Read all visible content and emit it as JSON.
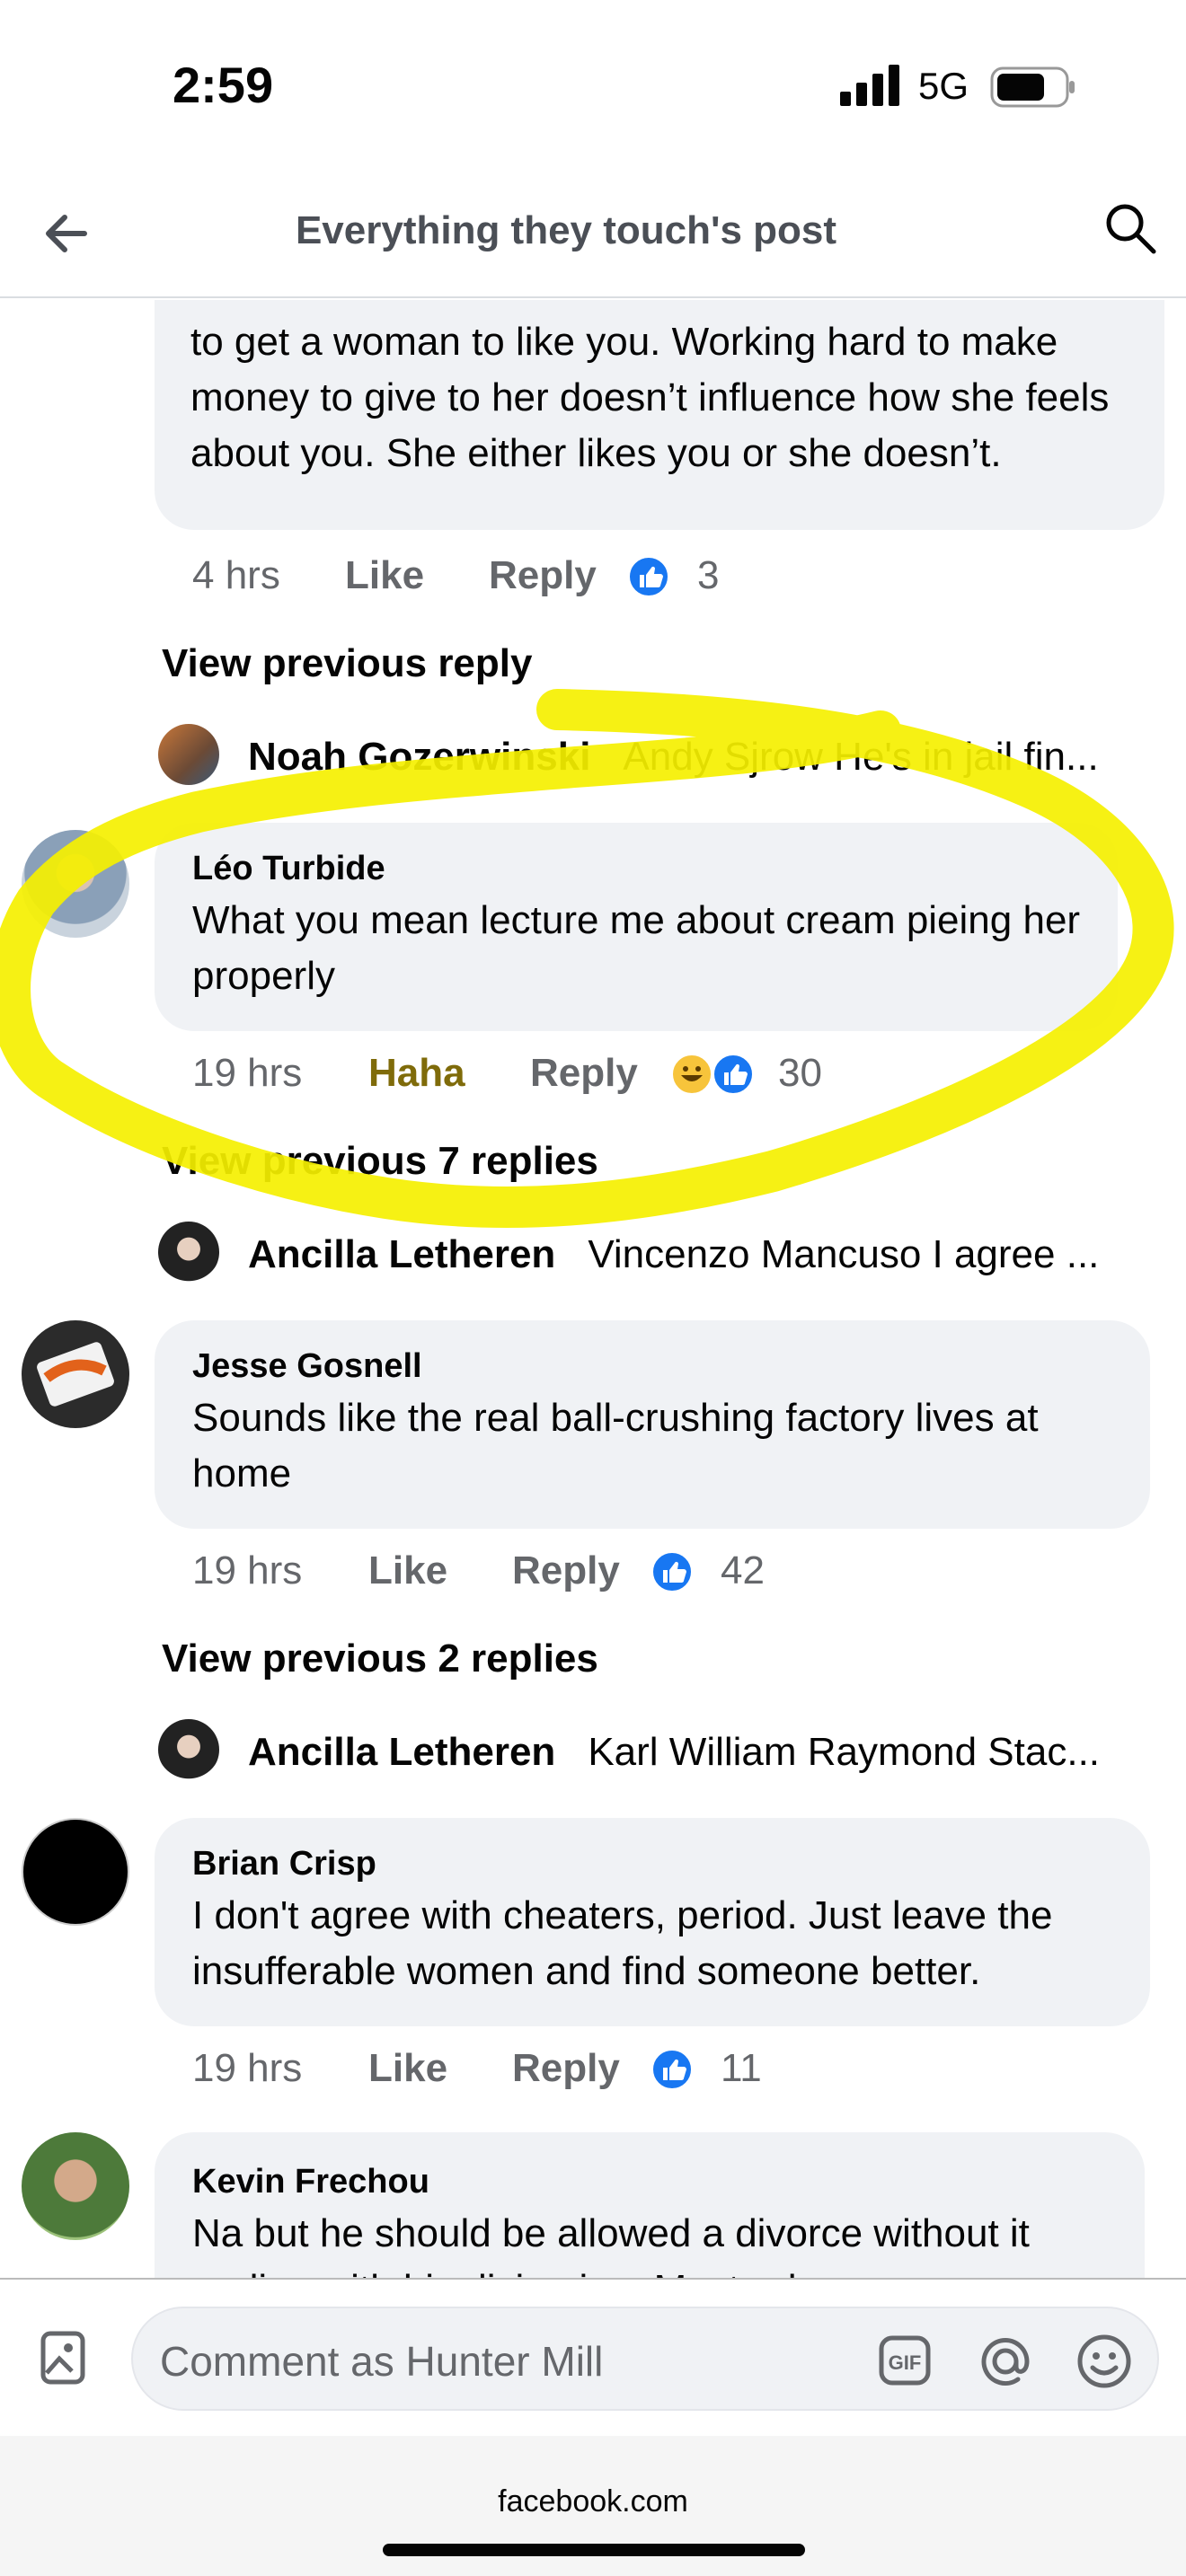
{
  "status_bar": {
    "time": "2:59",
    "network": "5G"
  },
  "header": {
    "title": "Everything they touch's post"
  },
  "comments": {
    "partial_top": {
      "text": "to get a woman to like you. Working hard to make money to give to her doesn’t influence how she feels about you. She either likes you or she doesn’t.",
      "time": "4 hrs",
      "like_label": "Like",
      "reply_label": "Reply",
      "reactions": "3"
    },
    "view_prev_1": "View previous reply",
    "reply_preview_1": {
      "name": "Noah Gozerwinski",
      "text": "Andy Sjrow He's in jail fin..."
    },
    "leo": {
      "name": "Léo Turbide",
      "text": "What you mean lecture me about cream pieing her properly",
      "time": "19 hrs",
      "like_label": "Haha",
      "reply_label": "Reply",
      "reactions": "30"
    },
    "view_prev_2": "View previous 7 replies",
    "reply_preview_2": {
      "name": "Ancilla Letheren",
      "text": "Vincenzo Mancuso I agree ..."
    },
    "jesse": {
      "name": "Jesse Gosnell",
      "text": "Sounds like the real ball-crushing factory lives at home",
      "time": "19 hrs",
      "like_label": "Like",
      "reply_label": "Reply",
      "reactions": "42"
    },
    "view_prev_3": "View previous 2 replies",
    "reply_preview_3": {
      "name": "Ancilla Letheren",
      "text": "Karl William Raymond Stac..."
    },
    "brian": {
      "name": "Brian Crisp",
      "text": "I don't agree with cheaters, period. Just leave the insufferable women and find someone better.",
      "time": "19 hrs",
      "like_label": "Like",
      "reply_label": "Reply",
      "reactions": "11"
    },
    "kevin": {
      "name": "Kevin Frechou",
      "text": "Na but he should be allowed a divorce without it ending with him living in a Mustard..."
    }
  },
  "composer": {
    "placeholder": "Comment as Hunter Mill"
  },
  "footer": {
    "domain": "facebook.com"
  },
  "colors": {
    "accent": "#1877f2",
    "haha": "#7f6b0a",
    "highlight": "#f5f000"
  }
}
